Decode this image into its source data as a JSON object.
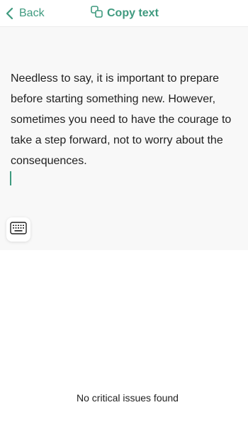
{
  "header": {
    "back_label": "Back",
    "back_icon": "chevron-left-icon",
    "copy_label": "Copy text",
    "copy_icon": "copy-icon"
  },
  "editor": {
    "text": "Needless to say, it is important to prepare before starting something new. However, sometimes you need to have the courage to take a step forward, not to worry about the consequences.",
    "keyboard_icon": "keyboard-icon"
  },
  "status": {
    "text": "No critical issues found"
  },
  "colors": {
    "accent": "#3f9a7f",
    "text": "#1f1f1f",
    "editor_background": "#f8f8f8",
    "background": "#ffffff"
  }
}
